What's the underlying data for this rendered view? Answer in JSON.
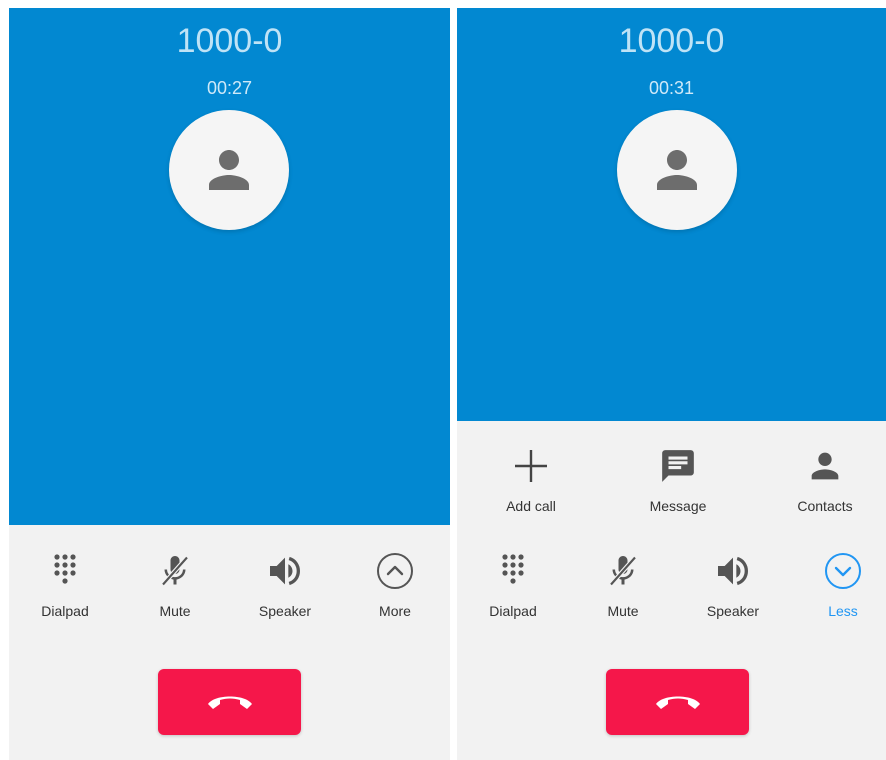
{
  "colors": {
    "header": "#0288d1",
    "end_call": "#f5174a",
    "accent": "#2196f3",
    "panel": "#f2f2f2"
  },
  "left": {
    "caller_name": "1000-0",
    "timer": "00:27",
    "controls": [
      {
        "label": "Dialpad",
        "icon": "dialpad-icon"
      },
      {
        "label": "Mute",
        "icon": "mic-off-icon"
      },
      {
        "label": "Speaker",
        "icon": "volume-icon"
      },
      {
        "label": "More",
        "icon": "chevron-up-circle-icon"
      }
    ]
  },
  "right": {
    "caller_name": "1000-0",
    "timer": "00:31",
    "extra_controls": [
      {
        "label": "Add call",
        "icon": "plus-icon"
      },
      {
        "label": "Message",
        "icon": "message-icon"
      },
      {
        "label": "Contacts",
        "icon": "person-icon"
      }
    ],
    "controls": [
      {
        "label": "Dialpad",
        "icon": "dialpad-icon"
      },
      {
        "label": "Mute",
        "icon": "mic-off-icon"
      },
      {
        "label": "Speaker",
        "icon": "volume-icon"
      },
      {
        "label": "Less",
        "icon": "chevron-down-circle-icon"
      }
    ]
  }
}
